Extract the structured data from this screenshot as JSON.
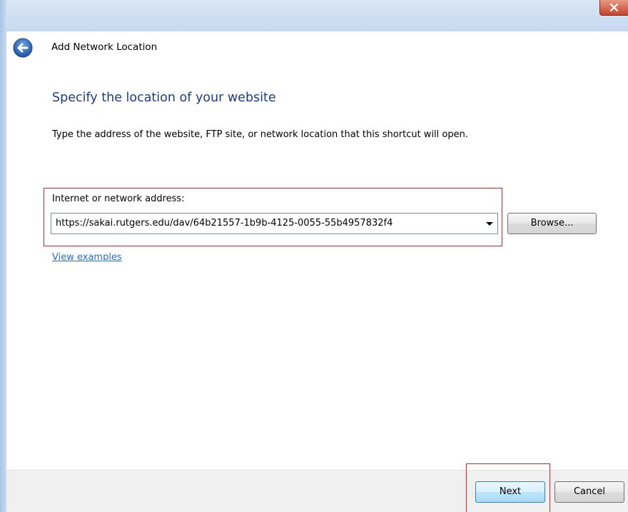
{
  "window": {
    "title": "Add Network Location",
    "close_icon": "close-icon",
    "back_icon": "back-arrow-icon"
  },
  "content": {
    "heading": "Specify the location of your website",
    "instructions": "Type the address of the website, FTP site, or network location that this shortcut will open."
  },
  "address": {
    "label": "Internet or network address:",
    "value": "https://sakai.rutgers.edu/dav/64b21557-1b9b-4125-0055-55b4957832f4",
    "dropdown_icon": "chevron-down-icon"
  },
  "buttons": {
    "browse": "Browse...",
    "next": "Next",
    "cancel": "Cancel"
  },
  "links": {
    "view_examples": "View examples"
  },
  "colors": {
    "heading": "#1e3d82",
    "link": "#2a6cc7",
    "highlight": "#d8232a"
  }
}
